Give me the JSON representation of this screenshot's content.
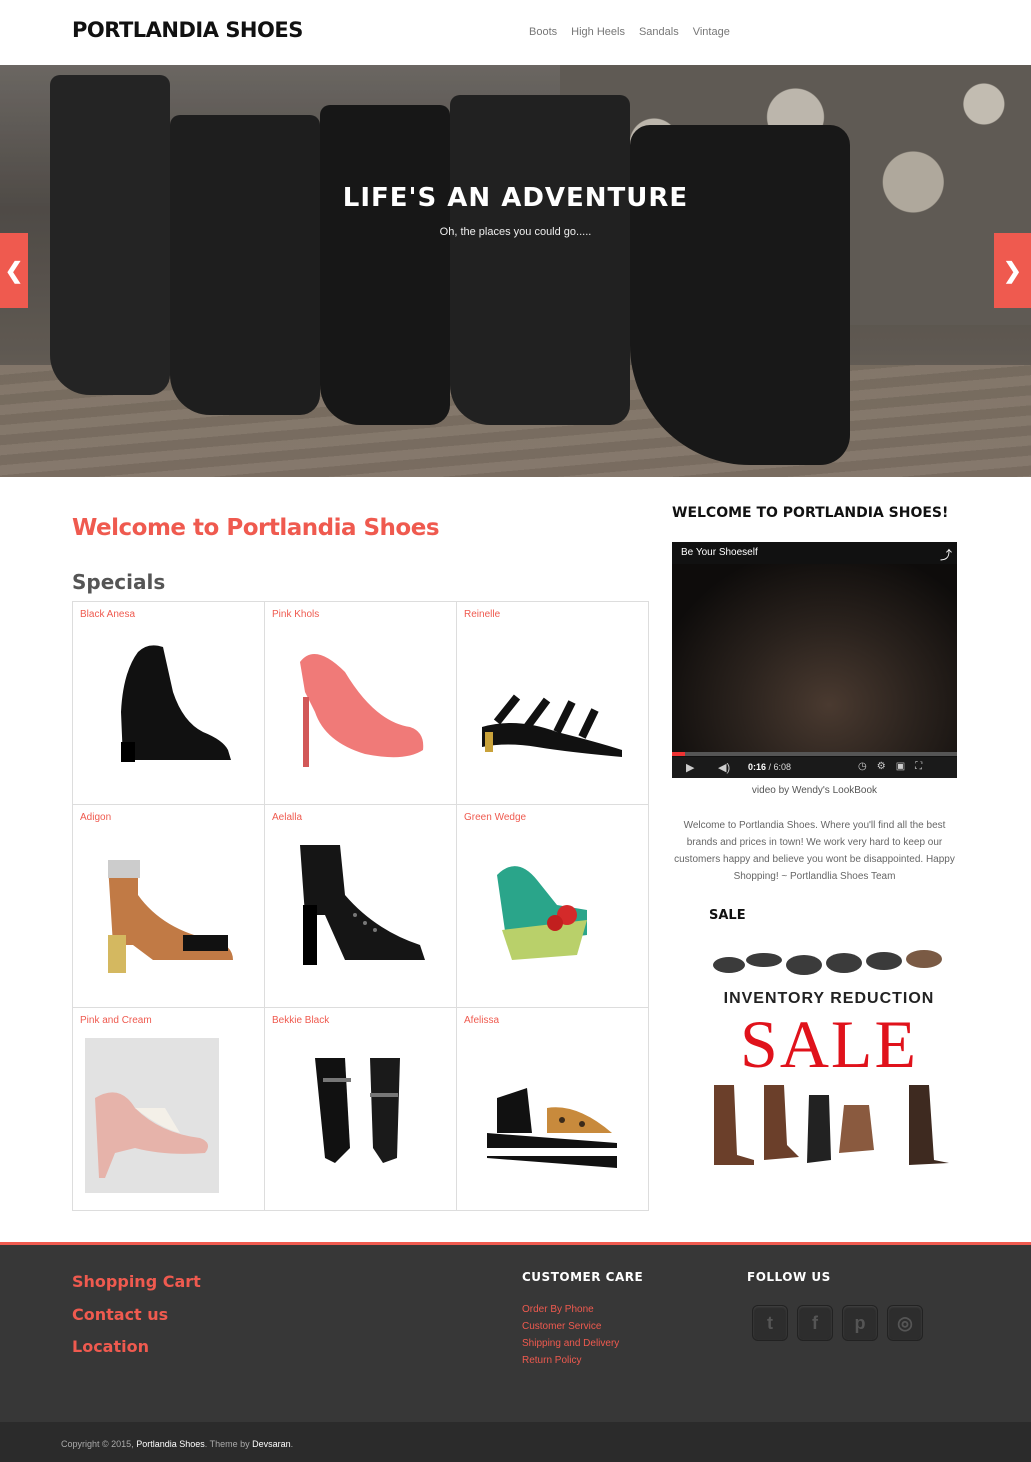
{
  "header": {
    "logo": "PORTLANDIA SHOES",
    "nav": [
      "Boots",
      "High Heels",
      "Sandals",
      "Vintage"
    ]
  },
  "hero": {
    "title": "LIFE'S AN ADVENTURE",
    "subtitle": "Oh, the places you could go.....",
    "prev_icon": "chevron-left-icon",
    "next_icon": "chevron-right-icon"
  },
  "main": {
    "title": "Welcome to Portlandia Shoes",
    "specials_title": "Specials",
    "products": [
      {
        "name": "Black Anesa"
      },
      {
        "name": "Pink Khols"
      },
      {
        "name": "Reinelle"
      },
      {
        "name": "Adigon"
      },
      {
        "name": "Aelalla"
      },
      {
        "name": "Green Wedge"
      },
      {
        "name": "Pink and Cream"
      },
      {
        "name": "Bekkie Black"
      },
      {
        "name": "Afelissa"
      }
    ]
  },
  "sidebar": {
    "title": "WELCOME TO PORTLANDIA SHOES!",
    "video": {
      "title": "Be Your Shoeself",
      "current_time": "0:16",
      "duration": "/ 6:08",
      "progress": 0.044
    },
    "video_caption": "video by Wendy's LookBook",
    "welcome_text": "Welcome to Portlandia Shoes. Where you'll find all the best brands and prices in town! We work very hard to keep our customers happy and believe you wont be disappointed. Happy Shopping! ~ Portlandlia Shoes Team",
    "sale_title": "SALE",
    "sale_banner_line1": "INVENTORY REDUCTION",
    "sale_banner_line2": "SALE"
  },
  "footer": {
    "links": [
      "Shopping Cart",
      "Contact us",
      "Location"
    ],
    "customer_care_title": "CUSTOMER CARE",
    "customer_care_links": [
      "Order By Phone",
      "Customer Service",
      "Shipping and Delivery",
      "Return Policy"
    ],
    "follow_title": "FOLLOW US",
    "social_icons": [
      "twitter-icon",
      "facebook-icon",
      "pinterest-icon",
      "instagram-icon"
    ],
    "copyright_prefix": "Copyright © 2015,",
    "copyright_site": "Portlandia Shoes",
    "copyright_mid": ". Theme by",
    "copyright_author": "Devsaran",
    "copyright_end": "."
  },
  "colors": {
    "accent": "#ef5a4f",
    "footer_bg": "#373737",
    "copyright_bg": "#2b2b2b"
  }
}
